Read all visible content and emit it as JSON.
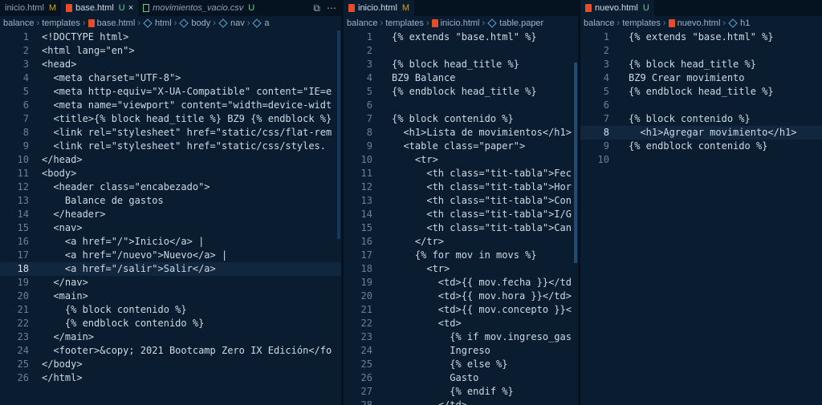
{
  "panes": [
    {
      "tabs": [
        {
          "label": "inicio.html",
          "status": "M",
          "active": false
        },
        {
          "label": "base.html",
          "status": "U",
          "active": true
        },
        {
          "label": "movimientos_vacio.csv",
          "status": "U",
          "active": false
        }
      ],
      "breadcrumb": [
        "balance",
        "templates",
        "base.html",
        "html",
        "body",
        "nav",
        "a"
      ],
      "lines": [
        "<!DOCTYPE html>",
        "<html lang=\"en\">",
        "<head>",
        "  <meta charset=\"UTF-8\">",
        "  <meta http-equiv=\"X-UA-Compatible\" content=\"IE=e",
        "  <meta name=\"viewport\" content=\"width=device-widt",
        "  <title>{% block head_title %} BZ9 {% endblock %}",
        "  <link rel=\"stylesheet\" href=\"static/css/flat-rem",
        "  <link rel=\"stylesheet\" href=\"static/css/styles.",
        "</head>",
        "<body>",
        "  <header class=\"encabezado\">",
        "    Balance de gastos",
        "  </header>",
        "  <nav>",
        "    <a href=\"/\">Inicio</a> |",
        "    <a href=\"/nuevo\">Nuevo</a> |",
        "    <a href=\"/salir\">Salir</a>",
        "  </nav>",
        "  <main>",
        "    {% block contenido %}",
        "    {% endblock contenido %}",
        "  </main>",
        "  <footer>&copy; 2021 Bootcamp Zero IX Edición</fo",
        "</body>",
        "</html>"
      ],
      "current_line": 18
    },
    {
      "tabs": [
        {
          "label": "inicio.html",
          "status": "M",
          "active": true
        }
      ],
      "breadcrumb": [
        "balance",
        "templates",
        "inicio.html",
        "table.paper"
      ],
      "lines": [
        "{% extends \"base.html\" %}",
        "",
        "{% block head_title %}",
        "BZ9 Balance",
        "{% endblock head_title %}",
        "",
        "{% block contenido %}",
        "  <h1>Lista de movimientos</h1>",
        "  <table class=\"paper\">",
        "    <tr>",
        "      <th class=\"tit-tabla\">Fec",
        "      <th class=\"tit-tabla\">Hor",
        "      <th class=\"tit-tabla\">Con",
        "      <th class=\"tit-tabla\">I/G",
        "      <th class=\"tit-tabla\">Can",
        "    </tr>",
        "    {% for mov in movs %}",
        "      <tr>",
        "        <td>{{ mov.fecha }}</td",
        "        <td>{{ mov.hora }}</td>",
        "        <td>{{ mov.concepto }}<",
        "        <td>",
        "          {% if mov.ingreso_gas",
        "          Ingreso",
        "          {% else %}",
        "          Gasto",
        "          {% endif %}",
        "        </td>"
      ],
      "current_line": 0
    },
    {
      "tabs": [
        {
          "label": "nuevo.html",
          "status": "U",
          "active": true
        }
      ],
      "breadcrumb": [
        "balance",
        "templates",
        "nuevo.html",
        "h1"
      ],
      "lines": [
        "{% extends \"base.html\" %}",
        "",
        "{% block head_title %}",
        "BZ9 Crear movimiento",
        "{% endblock head_title %}",
        "",
        "{% block contenido %}",
        "  <h1>Agregar movimiento</h1>",
        "{% endblock contenido %}",
        ""
      ],
      "current_line": 8
    }
  ],
  "colors": {
    "background": "#0a1d30",
    "text": "#cdd9e5",
    "line_number": "#6d7f93",
    "accent": "#2d6da3"
  }
}
